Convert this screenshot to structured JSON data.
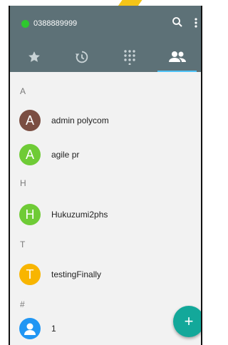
{
  "status": {
    "phone_number": "0388889999",
    "dot_color": "#2ec82e"
  },
  "header": {
    "background": "#5d7177",
    "icons": [
      "search-icon",
      "more-vert-icon"
    ],
    "tabs": [
      {
        "icon": "star-icon",
        "active": false
      },
      {
        "icon": "history-icon",
        "active": false
      },
      {
        "icon": "dialpad-icon",
        "active": false
      },
      {
        "icon": "contacts-icon",
        "active": true
      }
    ]
  },
  "contacts": {
    "sections": [
      {
        "letter": "A",
        "items": [
          {
            "initial": "A",
            "name": "admin polycom",
            "color": "#7b4e42"
          },
          {
            "initial": "A",
            "name": "agile pr",
            "color": "#6fcb36"
          }
        ]
      },
      {
        "letter": "H",
        "items": [
          {
            "initial": "H",
            "name": "Hukuzumi2phs",
            "color": "#6fcb36"
          }
        ]
      },
      {
        "letter": "T",
        "items": [
          {
            "initial": "T",
            "name": "testingFinally",
            "color": "#f8b500"
          }
        ]
      },
      {
        "letter": "#",
        "items": [
          {
            "initial": "",
            "name": "1",
            "color": "#2196f3",
            "icon": "person-icon"
          }
        ]
      }
    ]
  },
  "fab": {
    "label": "+",
    "color": "#13a89a"
  }
}
